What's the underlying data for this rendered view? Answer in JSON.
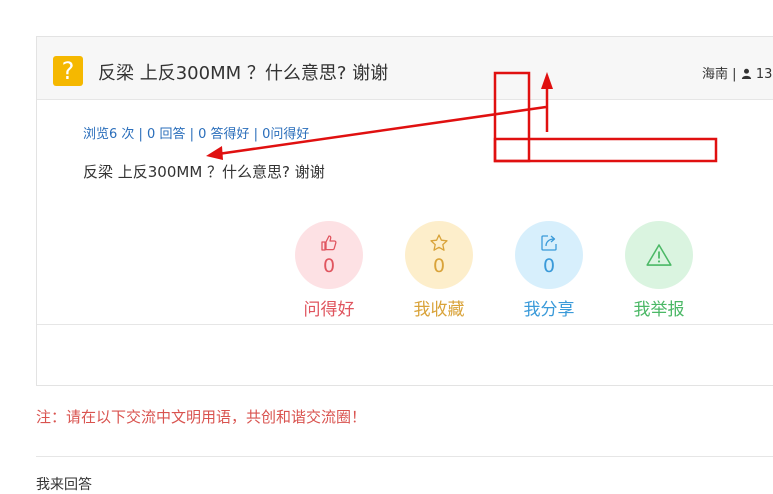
{
  "question": {
    "title": "反梁 上反300MM ？什么意思? 谢谢",
    "location": "海南",
    "user_count_partial": "13",
    "stats": "浏览6 次 | 0 回答 | 0 答得好 | 0问得好",
    "content": "反梁 上反300MM ？什么意思? 谢谢",
    "badge_glyph": "?"
  },
  "actions": [
    {
      "label": "问得好",
      "count": "0",
      "icon": "thumbs-up-icon",
      "color": "#e0555f"
    },
    {
      "label": "我收藏",
      "count": "0",
      "icon": "star-icon",
      "color": "#d9a33a"
    },
    {
      "label": "我分享",
      "count": "0",
      "icon": "share-icon",
      "color": "#3a9ad9"
    },
    {
      "label": "我举报",
      "count": "0",
      "icon": "warning-icon",
      "color": "#4bb866"
    }
  ],
  "notice": "注：请在以下交流中文明用语，共创和谐交流圈！",
  "answer_section_label": "我来回答",
  "annotation_color": "#e01010"
}
